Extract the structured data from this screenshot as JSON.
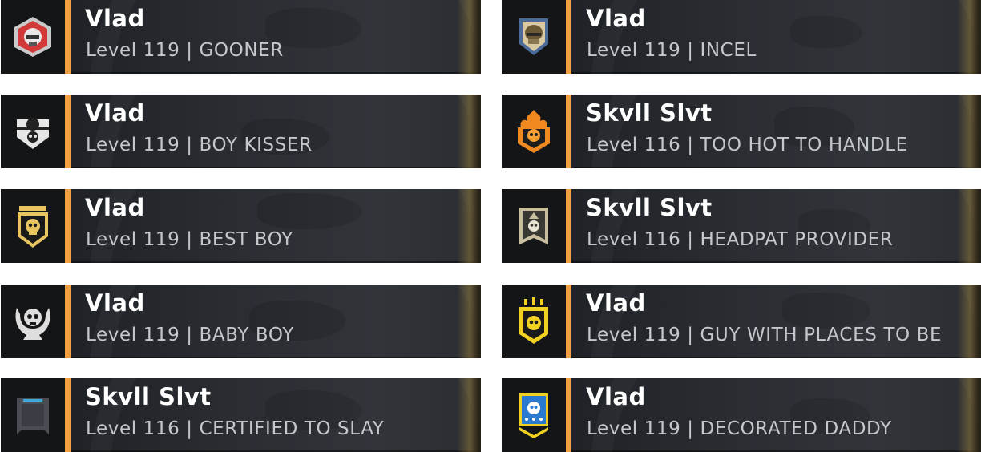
{
  "cards": [
    {
      "name": "Vlad",
      "level": "Level 119 | GOONER",
      "icon": "red-shield-helmet-emblem"
    },
    {
      "name": "Vlad",
      "level": "Level 119 | INCEL",
      "icon": "blue-helmet-emblem"
    },
    {
      "name": "Vlad",
      "level": "Level 119 | BOY KISSER",
      "icon": "white-skull-shield-emblem"
    },
    {
      "name": "Skvll Slvt",
      "level": "Level 116 | TOO HOT TO HANDLE",
      "icon": "orange-flaming-skull-emblem"
    },
    {
      "name": "Vlad",
      "level": "Level 119 | BEST BOY",
      "icon": "gold-skull-crest-emblem"
    },
    {
      "name": "Skvll Slvt",
      "level": "Level 116 | HEADPAT PROVIDER",
      "icon": "tan-skull-banner-emblem"
    },
    {
      "name": "Vlad",
      "level": "Level 119 | BABY BOY",
      "icon": "white-winged-skull-emblem"
    },
    {
      "name": "Vlad",
      "level": "Level 119 | GUY WITH PLACES TO BE",
      "icon": "yellow-skull-badge-emblem"
    },
    {
      "name": "Skvll Slvt",
      "level": "Level 116 | CERTIFIED TO SLAY",
      "icon": "grey-blue-plate-emblem"
    },
    {
      "name": "Vlad",
      "level": "Level 119 | DECORATED DADDY",
      "icon": "blue-star-skull-emblem"
    }
  ],
  "colors": {
    "accent": "#f0a040",
    "name_text": "#ffffff",
    "level_text": "#c4c7cc",
    "card_bg": "#1f2226"
  }
}
